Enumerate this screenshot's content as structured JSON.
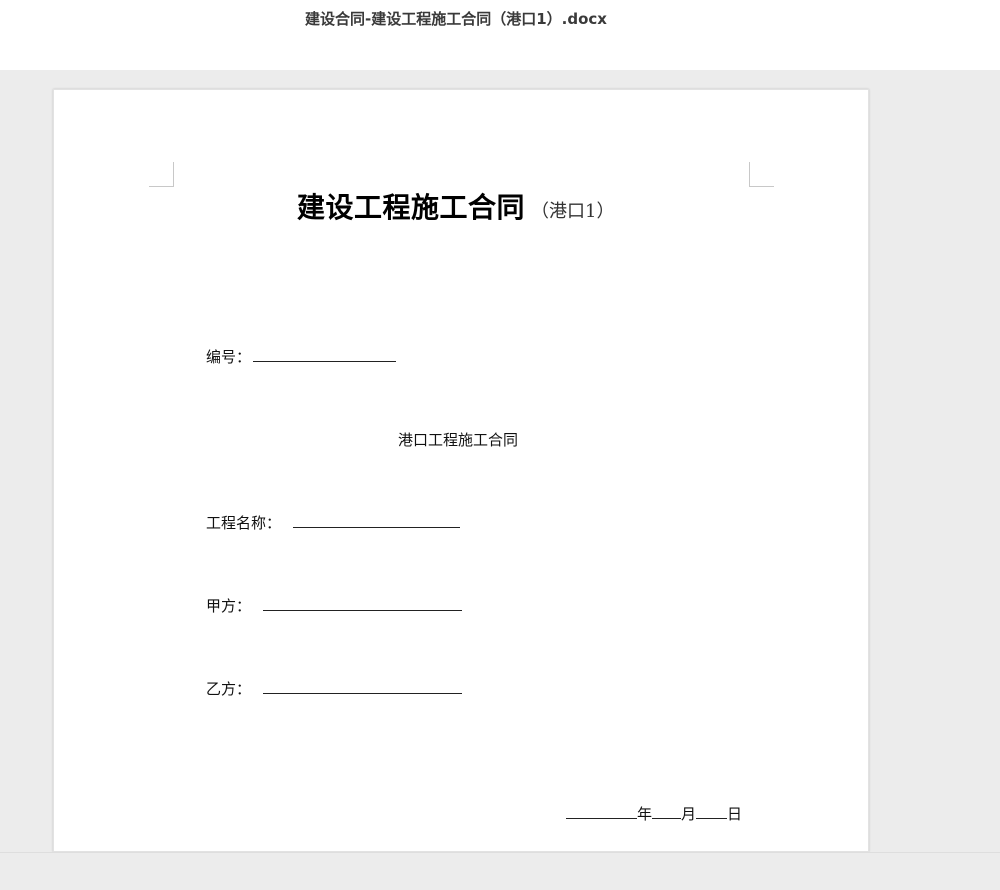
{
  "window": {
    "title": "建设合同-建设工程施工合同（港口1）.docx"
  },
  "document": {
    "heading_main": "建设工程施工合同",
    "heading_sub": "（港口1）",
    "number_label": "编号：",
    "subtitle": "港口工程施工合同",
    "project_name_label": "工程名称：",
    "party_a_label": "甲方：",
    "party_b_label": "乙方：",
    "date": {
      "year": "年",
      "month": "月",
      "day": "日"
    }
  },
  "colors": {
    "viewer_background": "#ececec",
    "page_background": "#ffffff",
    "title_text": "#3a3a3a"
  }
}
